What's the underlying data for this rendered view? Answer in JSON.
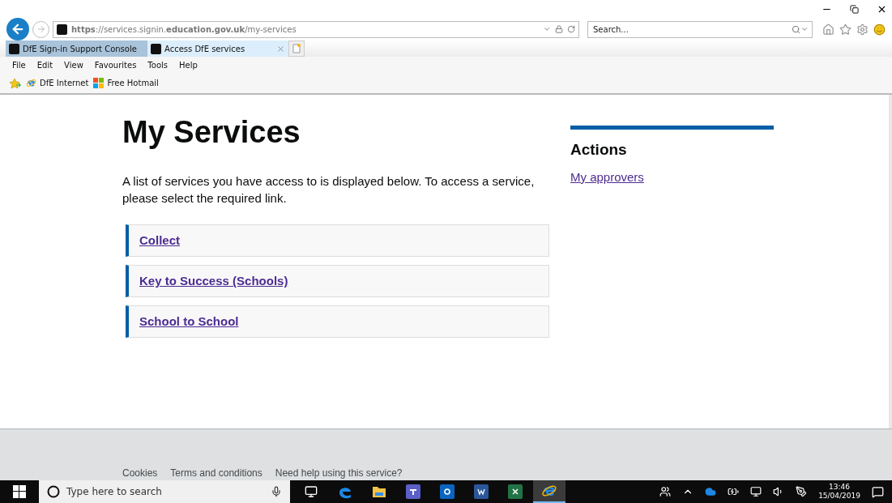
{
  "browser": {
    "address": "**https**://services.signin.**education.gov.uk**/my-services",
    "search": {
      "placeholder": "Search..."
    },
    "tabs": [
      {
        "label": "DfE Sign-in Support Console",
        "selected": false
      },
      {
        "label": "Access DfE services",
        "selected": true
      }
    ],
    "menu": [
      "File",
      "Edit",
      "View",
      "Favourites",
      "Tools",
      "Help"
    ],
    "favourites": [
      {
        "kind": "ie",
        "label": "DfE Internet"
      },
      {
        "kind": "windows",
        "label": "Free Hotmail"
      }
    ]
  },
  "page": {
    "heading": "My Services",
    "intro": "A list of services you have access to is displayed below. To access a service, please select the required link.",
    "services": [
      "Collect",
      "Key to Success (Schools)",
      "School to School"
    ],
    "actions": {
      "title": "Actions",
      "links": [
        "My approvers"
      ]
    },
    "footer_links": [
      "Cookies",
      "Terms and conditions",
      "Need help using this service?"
    ]
  },
  "taskbar": {
    "search": {
      "placeholder": "Type here to search"
    },
    "apps": [
      {
        "kind": "task-view",
        "active": false
      },
      {
        "kind": "edge",
        "active": false
      },
      {
        "kind": "explorer",
        "active": false
      },
      {
        "kind": "teams",
        "active": false
      },
      {
        "kind": "outlook",
        "active": false
      },
      {
        "kind": "word",
        "active": false
      },
      {
        "kind": "excel",
        "active": false
      },
      {
        "kind": "ie",
        "active": true
      }
    ],
    "time": "13:46",
    "date": "15/04/2019"
  }
}
